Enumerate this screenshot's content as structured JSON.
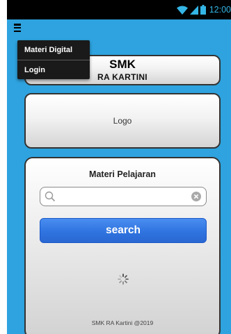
{
  "status_bar": {
    "time": "12:00",
    "icons": [
      "wifi-icon",
      "signal-icon",
      "battery-icon"
    ],
    "icon_color": "#34b5e5"
  },
  "menu": {
    "items": [
      {
        "label": "Materi Digital"
      },
      {
        "label": "Login"
      }
    ]
  },
  "header": {
    "title": "SMK",
    "subtitle": "RA KARTINI"
  },
  "logo_card": {
    "label": "Logo"
  },
  "main": {
    "heading": "Materi Pelajaran",
    "search": {
      "value": "",
      "placeholder": ""
    },
    "search_button_label": "search",
    "footer": "SMK RA Kartini @2019"
  },
  "colors": {
    "background": "#2ea3df",
    "button": "#2f74e0",
    "menu": "#1a1a1a"
  }
}
